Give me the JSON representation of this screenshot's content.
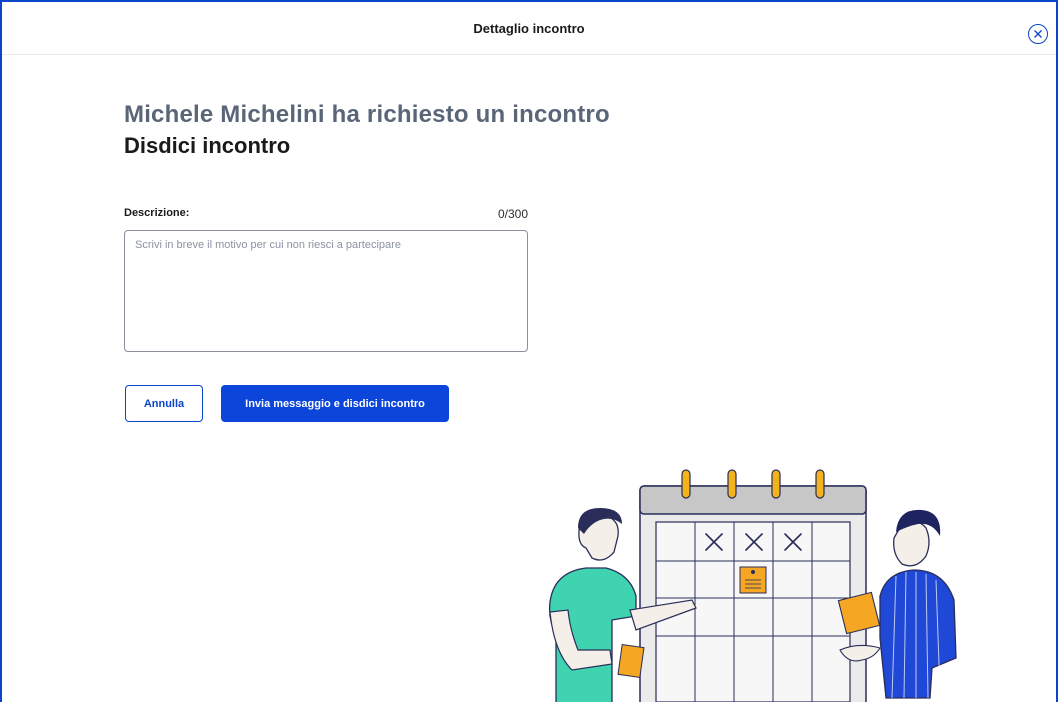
{
  "header": {
    "title": "Dettaglio incontro"
  },
  "main": {
    "requester_title": "Michele Michelini ha richiesto un incontro",
    "action_title": "Disdici incontro",
    "description": {
      "label": "Descrizione:",
      "counter": "0/300",
      "value": "",
      "placeholder": "Scrivi in breve il motivo per cui non riesci a partecipare"
    },
    "buttons": {
      "cancel": "Annulla",
      "submit": "Invia messaggio e disdici incontro"
    }
  },
  "colors": {
    "accent": "#0b45d9",
    "title_gray": "#5a6678",
    "calendar_ring": "#f2b31b",
    "person_left_shirt": "#3fd3b0",
    "person_right_shirt": "#1f48d6"
  },
  "icons": {
    "close": "close-circle-icon",
    "illustration": "calendar-meeting-illustration"
  }
}
